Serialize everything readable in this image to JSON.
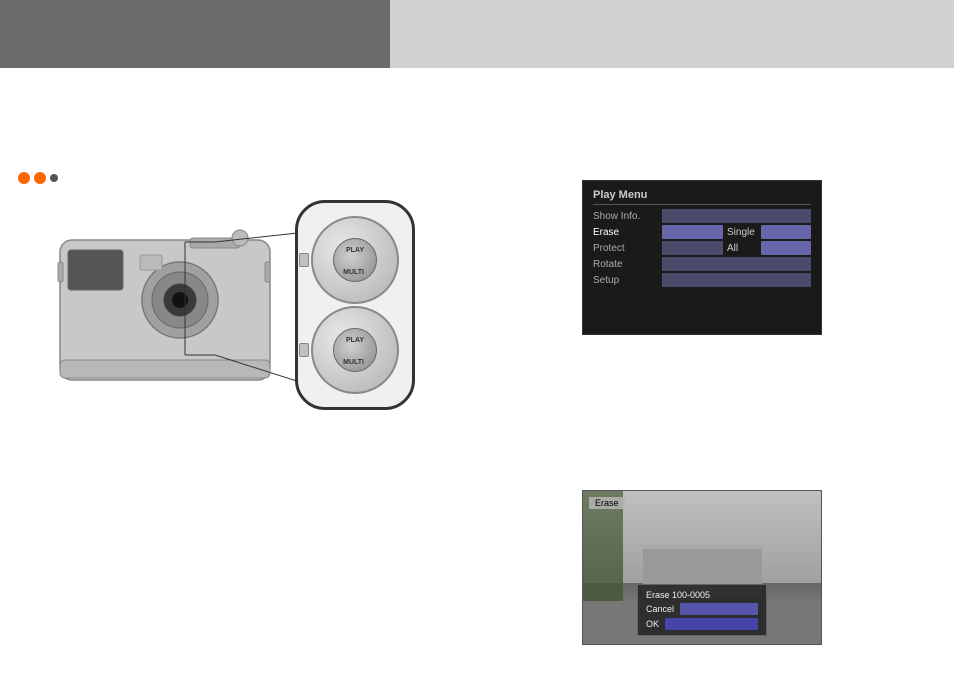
{
  "banner": {
    "left_bg": "#6b6b6b",
    "right_bg": "#d0d0d0"
  },
  "bullets": {
    "dot1": "filled",
    "dot2": "filled",
    "dot3": "small"
  },
  "play_menu": {
    "title": "Play Menu",
    "items": [
      {
        "label": "Show Info.",
        "bar": true,
        "value": ""
      },
      {
        "label": "Erase",
        "bar": true,
        "value": "Single",
        "highlighted": true
      },
      {
        "label": "Protect",
        "bar": true,
        "value": "All",
        "highlighted": false
      },
      {
        "label": "Rotate",
        "bar": true,
        "value": ""
      },
      {
        "label": "Setup",
        "bar": true,
        "value": ""
      }
    ]
  },
  "erase_screen": {
    "label": "Erase",
    "dialog": {
      "line1": "Erase 100-0005",
      "line2": "Cancel",
      "line3": "OK"
    }
  },
  "dial": {
    "label_play": "PLAY",
    "label_multi": "MULTI"
  }
}
